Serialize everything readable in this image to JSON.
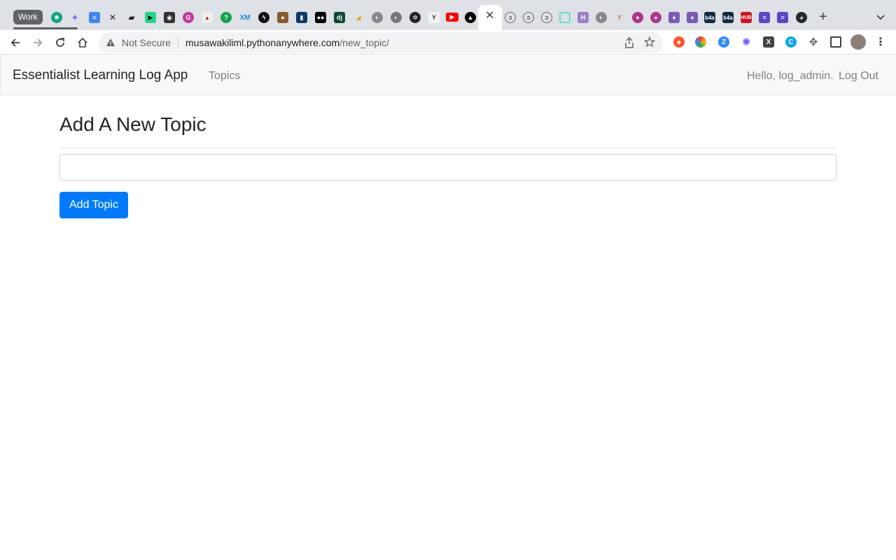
{
  "browser": {
    "tab_group_label": "Work",
    "address_security": "Not Secure",
    "url_host": "musawakiliml.pythonanywhere.com",
    "url_path": "/new_topic/",
    "tab_favicons": [
      "chatgpt-icon",
      "gemini-icon",
      "docs-icon",
      "linear-icon",
      "notes-icon",
      "code-icon",
      "github-copilot-icon",
      "grammarly-icon",
      "app-icon",
      "question-icon",
      "xm-icon",
      "spark-icon",
      "cookie-icon",
      "trello-icon",
      "medium-icon",
      "django-icon",
      "banana-icon",
      "globe-icon",
      "globe-icon",
      "openai-icon",
      "ycombinator-icon",
      "youtube-icon",
      "vercel-icon",
      "pythonanywhere-icon",
      "pythonanywhere-icon",
      "pythonanywhere-icon",
      "square-icon",
      "heroku-icon",
      "globe-icon",
      "fork-icon",
      "circle-icon",
      "circle-icon",
      "drop-icon",
      "drop-icon",
      "b4a-icon",
      "b4a-icon",
      "hub-icon",
      "list-icon",
      "list-icon",
      "github-icon"
    ],
    "extensions": [
      "brave-shield-icon",
      "color-wheel-icon",
      "zoom-icon",
      "spark-icon",
      "x-icon",
      "c-icon",
      "puzzle-icon",
      "sidepanel-icon",
      "avatar"
    ]
  },
  "navbar": {
    "brand": "Essentialist Learning Log App",
    "topics_link": "Topics",
    "greeting": "Hello, log_admin.",
    "logout": "Log Out"
  },
  "main": {
    "title": "Add A New Topic",
    "topic_input_value": "",
    "submit_label": "Add Topic"
  },
  "colors": {
    "primary_button": "#007bff",
    "navbar_bg": "#f8f9fa",
    "text": "#212529",
    "nav_link": "#7a7f84"
  }
}
